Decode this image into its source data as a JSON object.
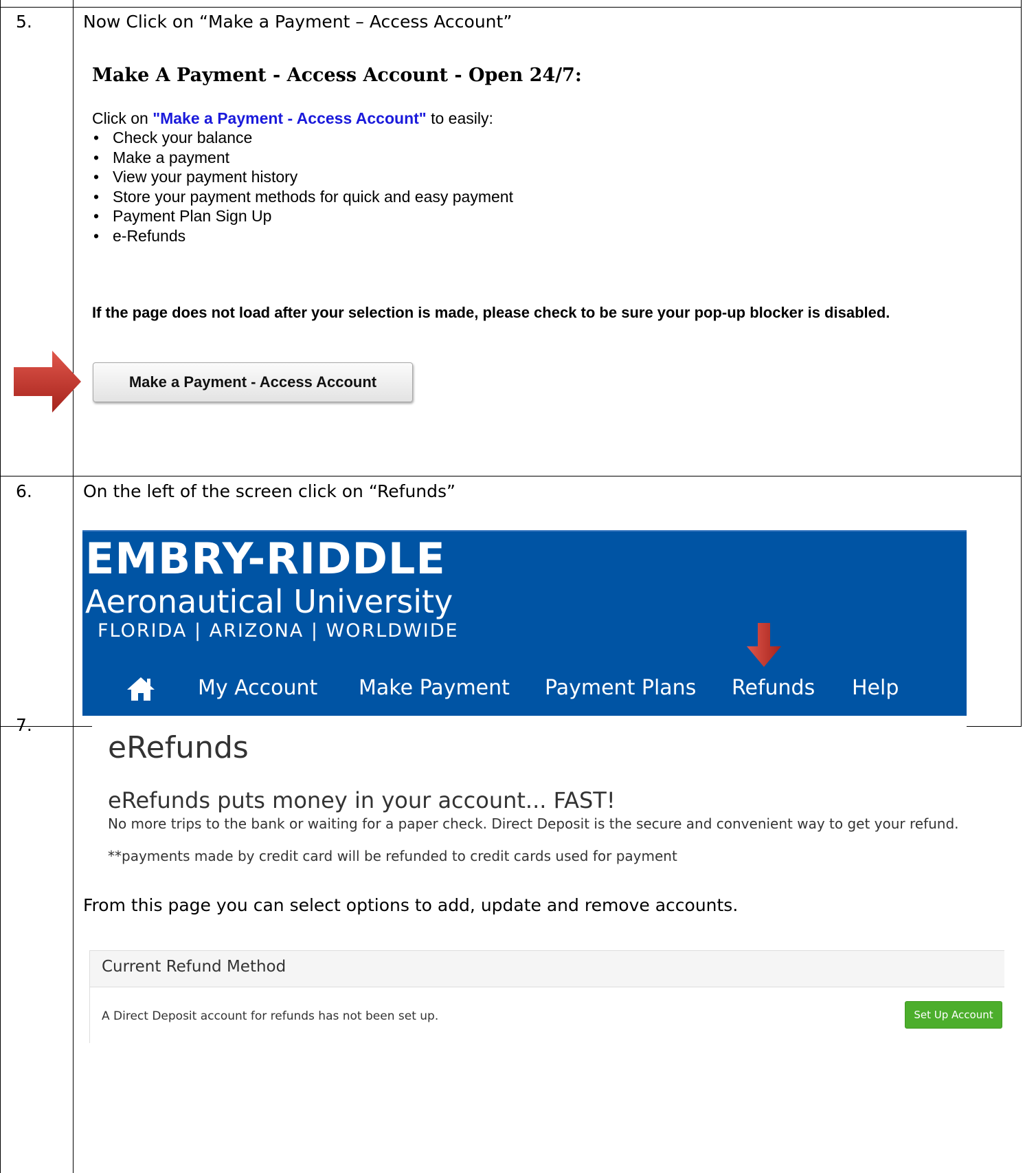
{
  "steps": {
    "s5": {
      "number": "5.",
      "instruction": "Now Click on “Make a Payment – Access Account”",
      "heading": "Make A Payment - Access Account - Open 24/7:",
      "intro_prefix": "Click on ",
      "intro_link": "\"Make a Payment - Access Account\"",
      "intro_suffix": " to easily:",
      "bullets": [
        "Check your balance",
        "Make a payment",
        "View your payment history",
        "Store your payment methods for quick and easy payment",
        "Payment Plan Sign Up",
        "e-Refunds"
      ],
      "warning": "If the page does not load after your selection is made, please check to be sure your pop-up blocker is disabled.",
      "button_label": "Make a Payment - Access Account"
    },
    "s6": {
      "number": "6.",
      "instruction": "On the left of the screen click on “Refunds”",
      "brand_line1": "EMBRY-RIDDLE",
      "brand_line2": "Aeronautical University",
      "brand_line3": "FLORIDA | ARIZONA | WORLDWIDE",
      "nav": [
        "My Account",
        "Make Payment",
        "Payment Plans",
        "Refunds",
        "Help"
      ]
    },
    "s7": {
      "number": "7.",
      "title": "eRefunds",
      "subtitle": "eRefunds puts money in your account... FAST!",
      "description": "No more trips to the bank or waiting for a paper check. Direct Deposit is the secure and convenient way to get your refund.",
      "note": "**payments made by credit card will be refunded to credit cards used for payment",
      "from_page": "From this page you can select options to add, update and remove accounts.",
      "panel_title": "Current Refund Method",
      "panel_message": "A Direct Deposit account for refunds has not been set up.",
      "setup_button": "Set Up Account"
    }
  },
  "colors": {
    "banner_blue": "#0054a4",
    "link_blue": "#1a1adb",
    "arrow_red": "#c4322a",
    "setup_green": "#4cae2c"
  }
}
